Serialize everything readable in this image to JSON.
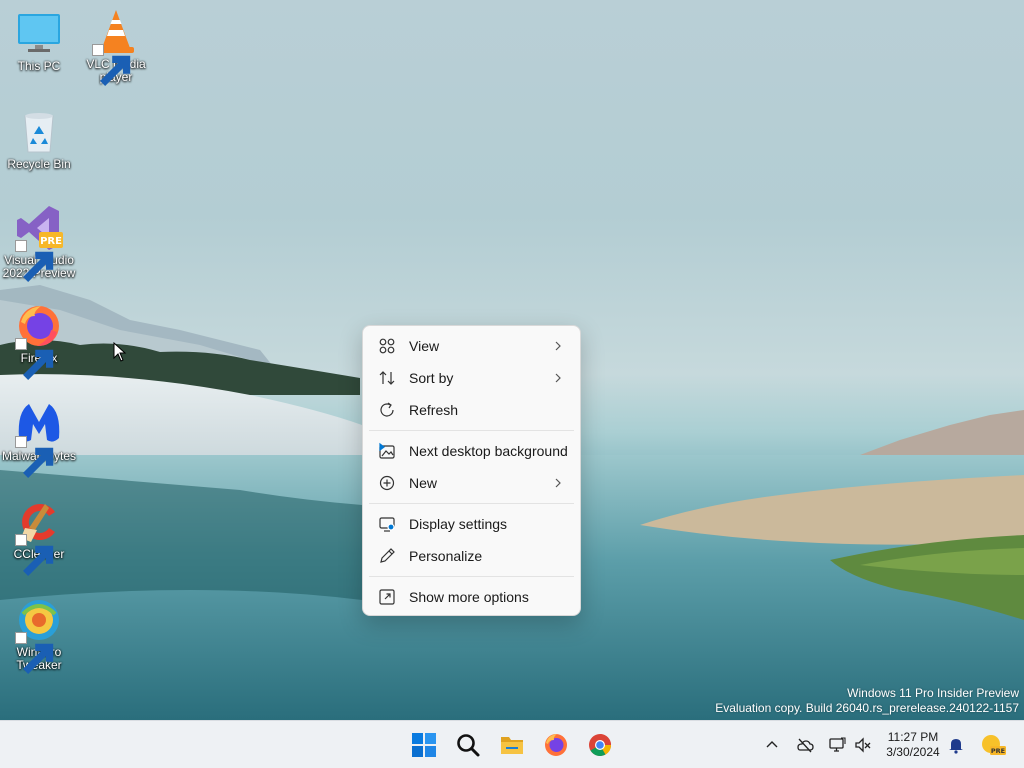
{
  "desktop": {
    "icons": [
      {
        "label": "This PC",
        "icon": "this-pc-icon"
      },
      {
        "label": "VLC media player",
        "icon": "vlc-icon"
      },
      {
        "label": "Recycle Bin",
        "icon": "recycle-bin-icon"
      },
      {
        "label": "Visual Studio 2022 Preview",
        "icon": "visual-studio-icon",
        "badge": "PRE"
      },
      {
        "label": "Firefox",
        "icon": "firefox-icon"
      },
      {
        "label": "Malwarebytes",
        "icon": "malwarebytes-icon"
      },
      {
        "label": "CCleaner",
        "icon": "ccleaner-icon"
      },
      {
        "label": "Winaero Tweaker",
        "icon": "winaero-tweaker-icon"
      }
    ]
  },
  "context_menu": {
    "items": [
      {
        "label": "View",
        "icon": "grid-view-icon",
        "submenu": true
      },
      {
        "label": "Sort by",
        "icon": "sort-icon",
        "submenu": true
      },
      {
        "label": "Refresh",
        "icon": "refresh-icon",
        "submenu": false
      },
      {
        "label": "Next desktop background",
        "icon": "next-background-icon",
        "submenu": false
      },
      {
        "label": "New",
        "icon": "plus-circle-icon",
        "submenu": true
      },
      {
        "label": "Display settings",
        "icon": "display-settings-icon",
        "submenu": false
      },
      {
        "label": "Personalize",
        "icon": "pen-icon",
        "submenu": false
      },
      {
        "label": "Show more options",
        "icon": "show-more-icon",
        "submenu": false
      }
    ]
  },
  "watermark": {
    "line1": "Windows 11 Pro Insider Preview",
    "line2": "Evaluation copy. Build 26040.rs_prerelease.240122-1157"
  },
  "taskbar": {
    "apps": [
      "start-icon",
      "search-icon",
      "file-explorer-icon",
      "firefox-icon",
      "chrome-icon"
    ],
    "tray": [
      "chevron-up-icon",
      "onedrive-offline-icon",
      "network-icon",
      "volume-muted-icon",
      "notification-bell-icon",
      "dev-home-icon"
    ],
    "tray_badge": "PRE",
    "time": "11:27 PM",
    "date": "3/30/2024"
  },
  "colors": {
    "accent": "#0078d4",
    "menu_bg": "#f9f9f9",
    "taskbar_bg": "#eef1f4"
  }
}
